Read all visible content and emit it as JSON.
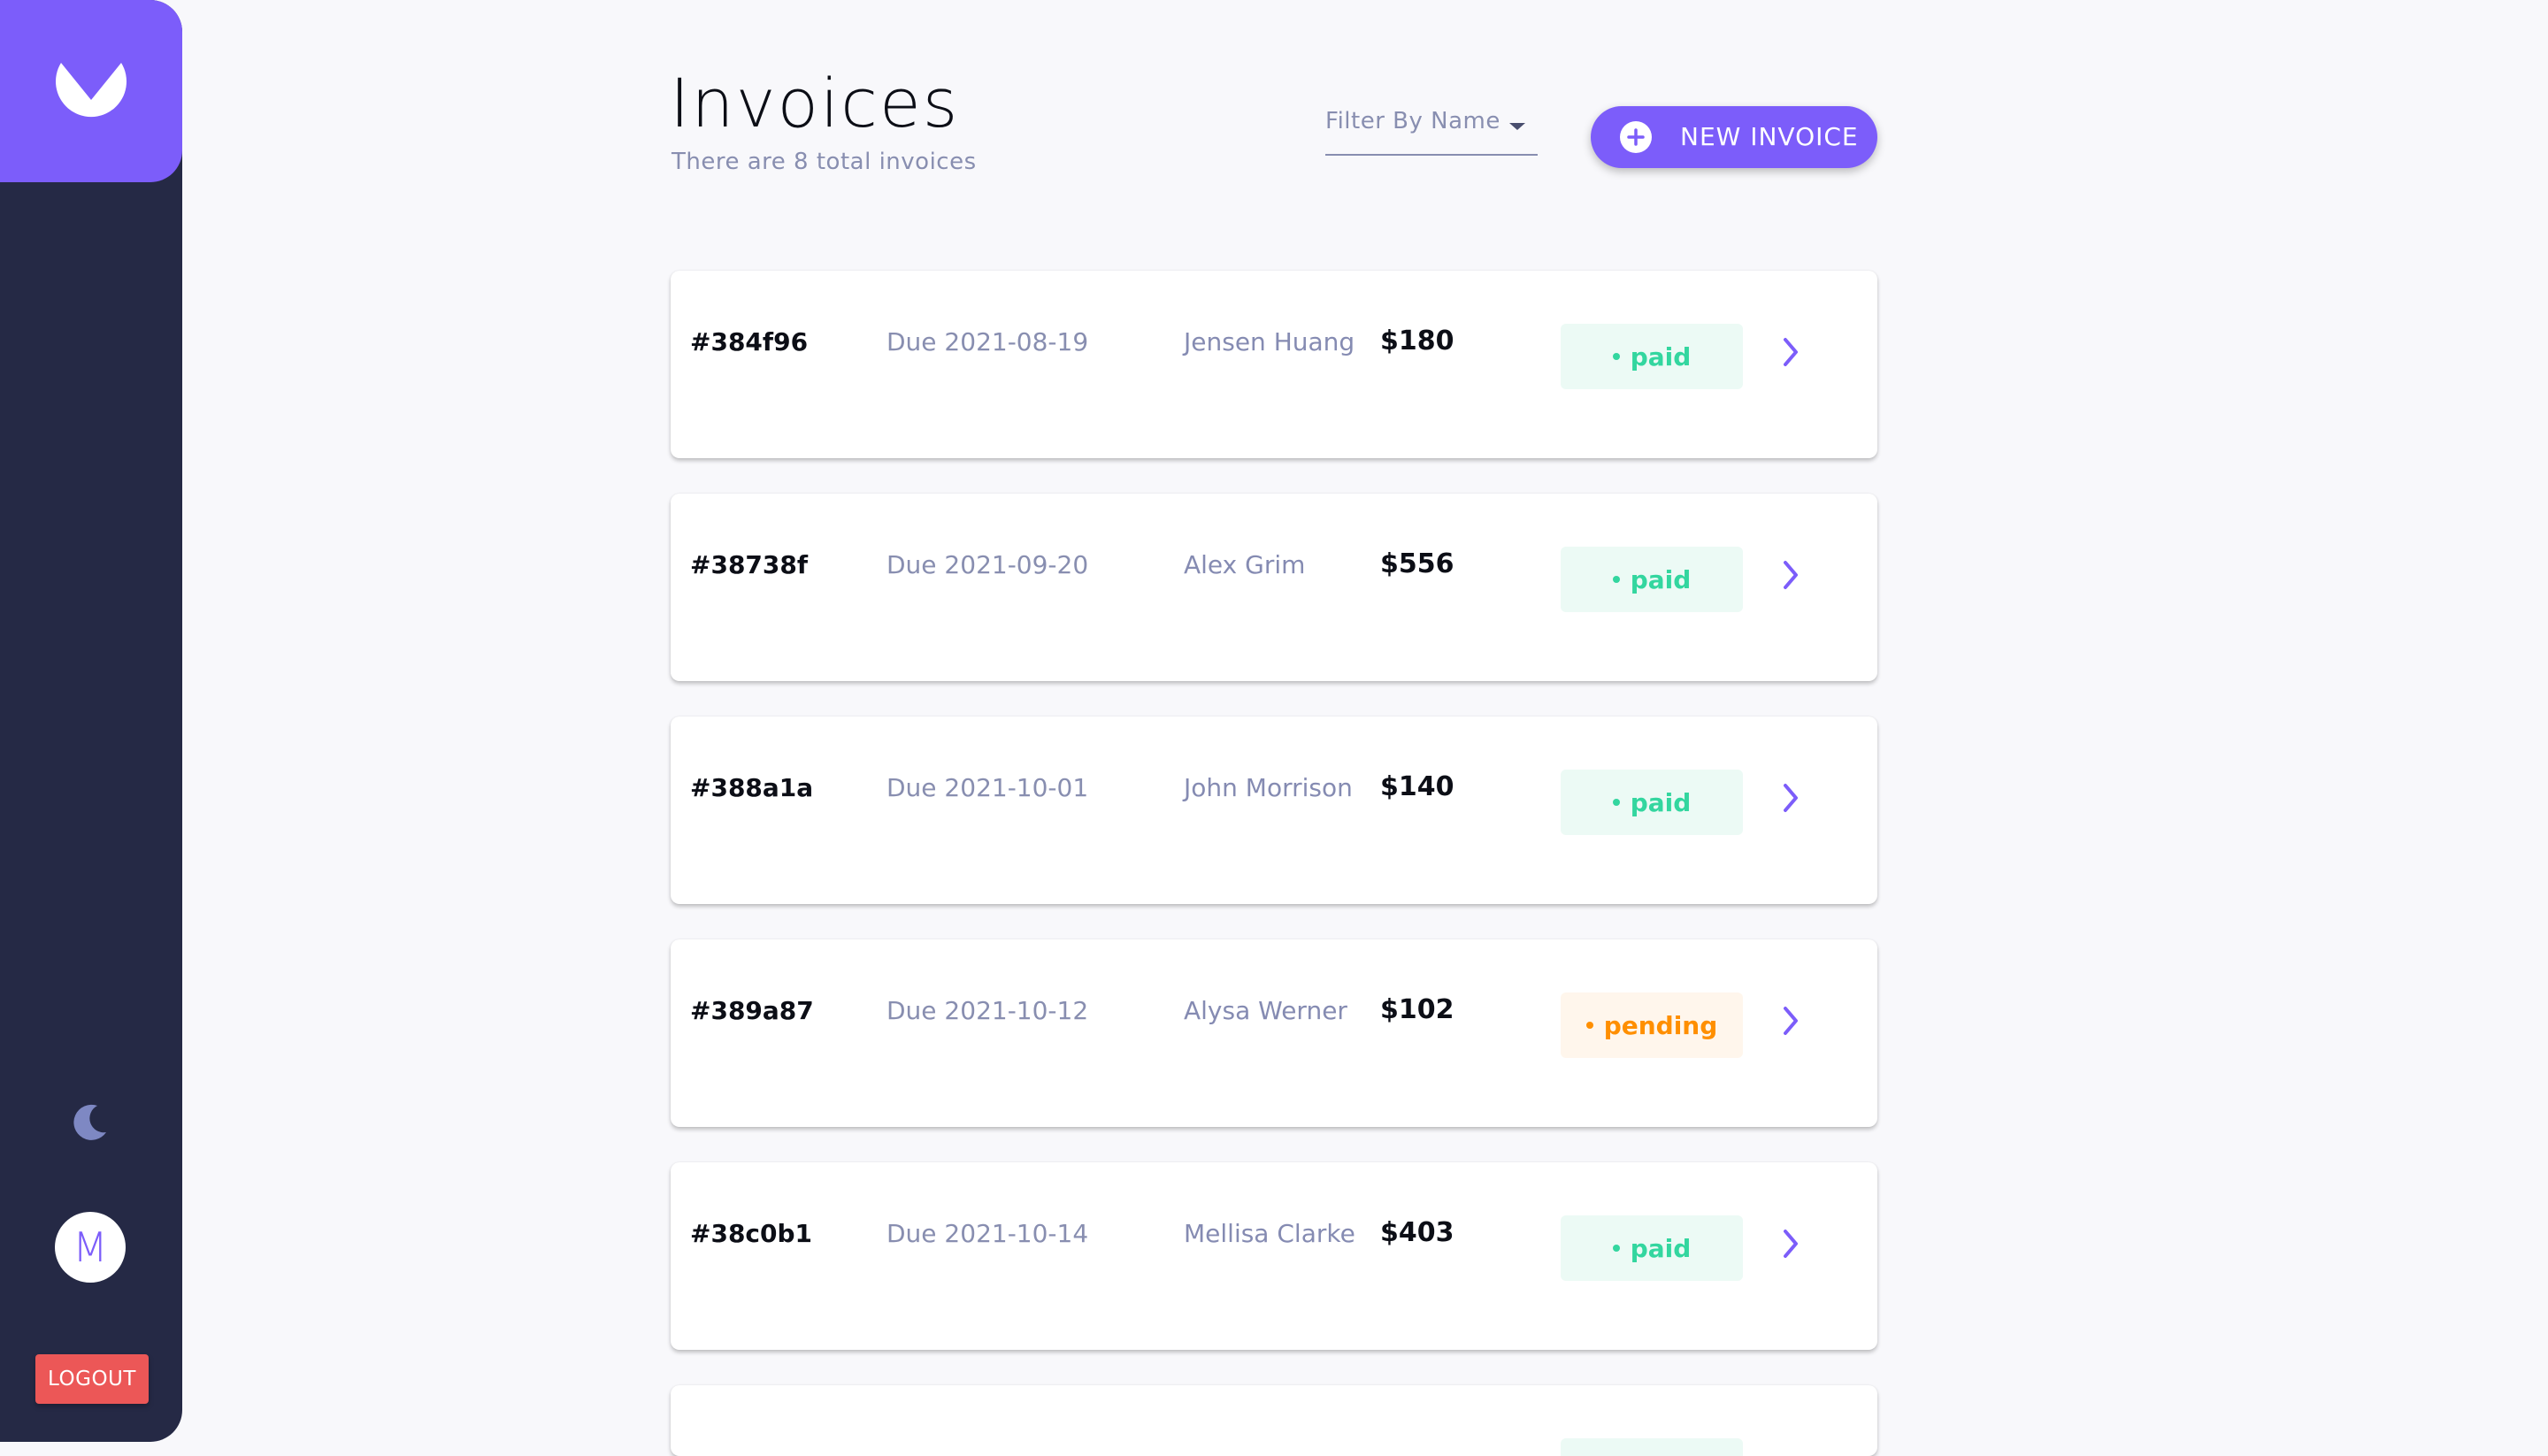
{
  "sidebar": {
    "logo_icon": "app-logo-icon",
    "theme_icon": "moon-icon",
    "avatar_initial": "M",
    "logout_label": "LOGOUT"
  },
  "header": {
    "title": "Invoices",
    "subtitle": "There are 8 total invoices",
    "filter_label": "Filter By Name",
    "new_invoice_label": "NEW INVOICE"
  },
  "invoices": [
    {
      "id": "#384f96",
      "due": "Due 2021-08-19",
      "client": "Jensen Huang",
      "total": "$180",
      "status": "paid"
    },
    {
      "id": "#38738f",
      "due": "Due 2021-09-20",
      "client": "Alex Grim",
      "total": "$556",
      "status": "paid"
    },
    {
      "id": "#388a1a",
      "due": "Due 2021-10-01",
      "client": "John Morrison",
      "total": "$140",
      "status": "paid"
    },
    {
      "id": "#389a87",
      "due": "Due 2021-10-12",
      "client": "Alysa Werner",
      "total": "$102",
      "status": "pending"
    },
    {
      "id": "#38c0b1",
      "due": "Due 2021-10-14",
      "client": "Mellisa Clarke",
      "total": "$403",
      "status": "paid"
    }
  ],
  "colors": {
    "accent": "#7c5dfa",
    "sidebar": "#252945",
    "paid": "#33d69f",
    "pending": "#ff8f00",
    "logout": "#ec5757"
  }
}
